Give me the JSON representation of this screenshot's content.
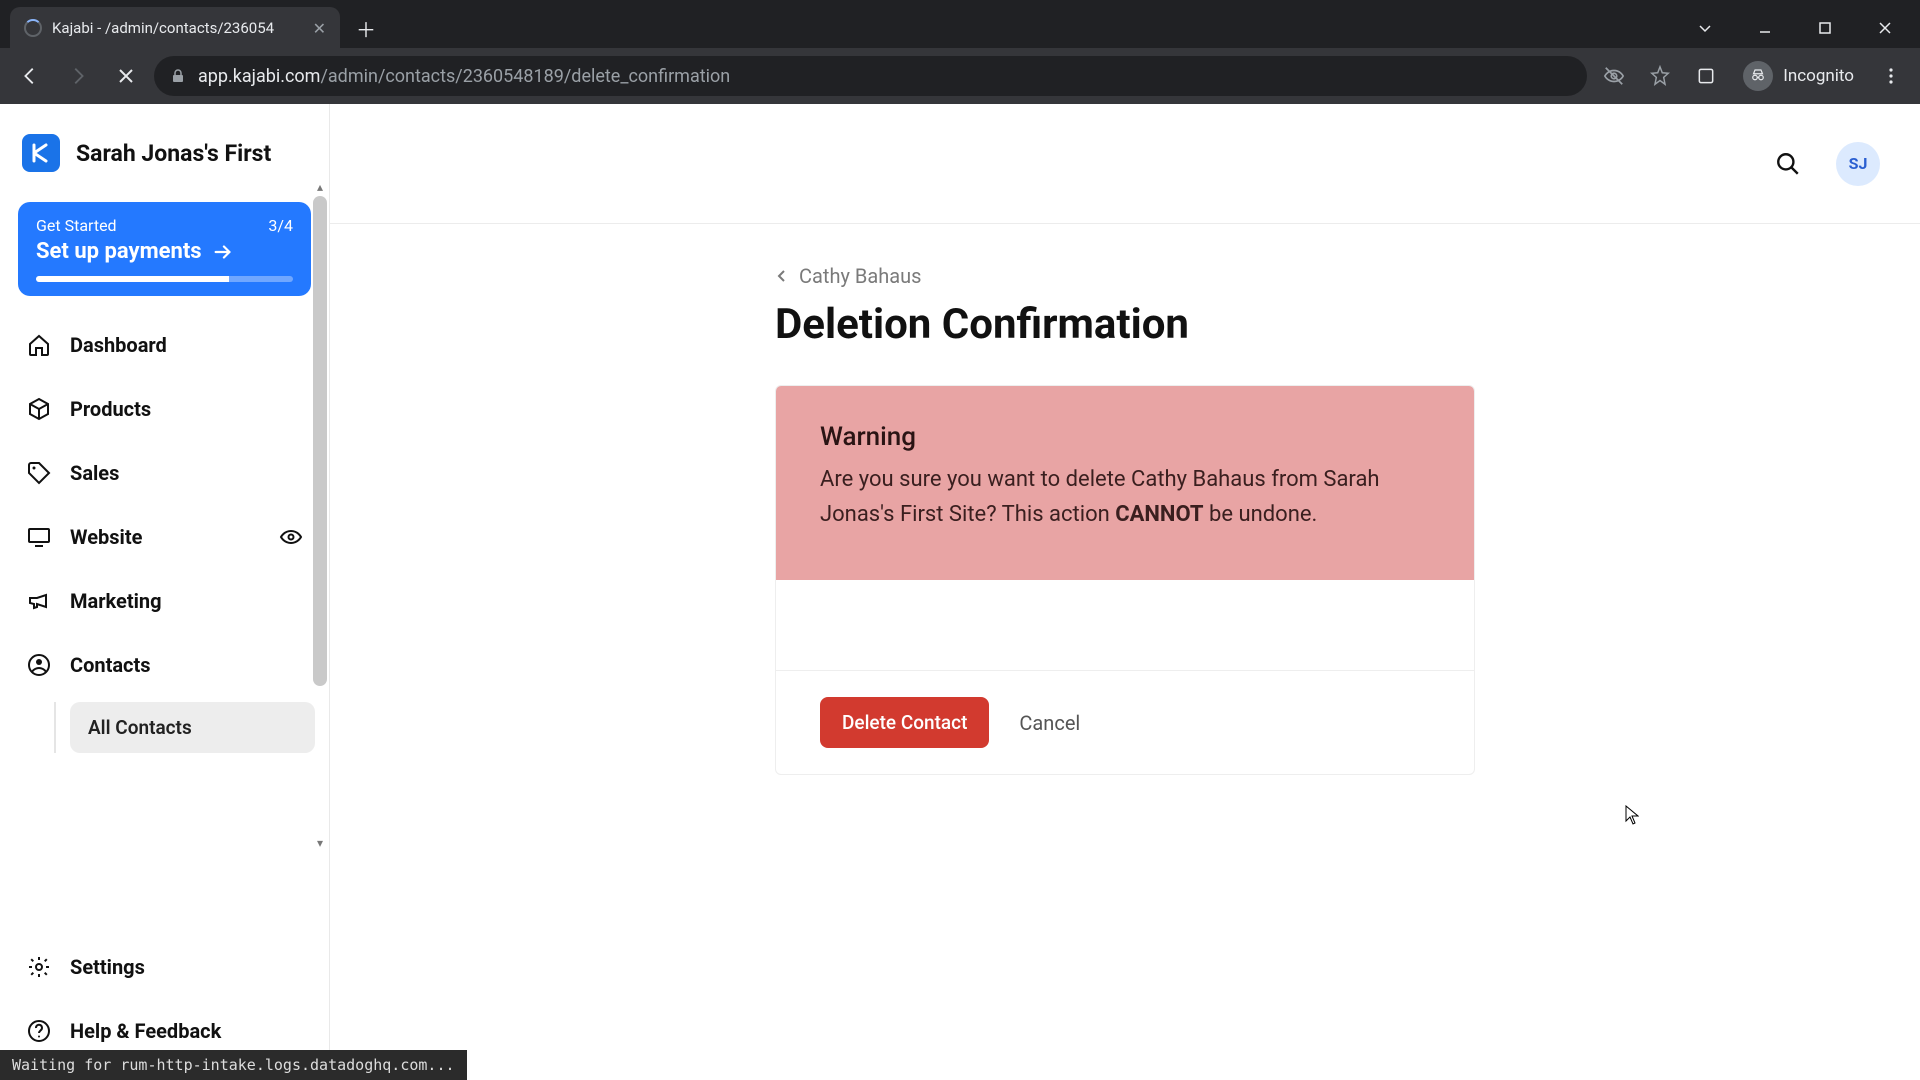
{
  "browser": {
    "tab_title": "Kajabi - /admin/contacts/236054",
    "url_domain": "app.kajabi.com",
    "url_path": "/admin/contacts/2360548189/delete_confirmation",
    "incognito_label": "Incognito"
  },
  "brand": {
    "title": "Sarah Jonas's First",
    "logo_letter": "K"
  },
  "get_started": {
    "label": "Get Started",
    "progress_text": "3/4",
    "cta": "Set up payments"
  },
  "nav": {
    "dashboard": "Dashboard",
    "products": "Products",
    "sales": "Sales",
    "website": "Website",
    "marketing": "Marketing",
    "contacts": "Contacts",
    "all_contacts": "All Contacts",
    "settings": "Settings",
    "help": "Help & Feedback"
  },
  "header": {
    "avatar_initials": "SJ"
  },
  "main": {
    "breadcrumb": "Cathy Bahaus",
    "title": "Deletion Confirmation",
    "warning_title": "Warning",
    "warning_text_1": "Are you sure you want to delete Cathy Bahaus from Sarah Jonas's First Site? This action ",
    "warning_emphasis": "CANNOT",
    "warning_text_2": " be undone.",
    "delete_button": "Delete Contact",
    "cancel_button": "Cancel"
  },
  "status": "Waiting for rum-http-intake.logs.datadoghq.com..."
}
